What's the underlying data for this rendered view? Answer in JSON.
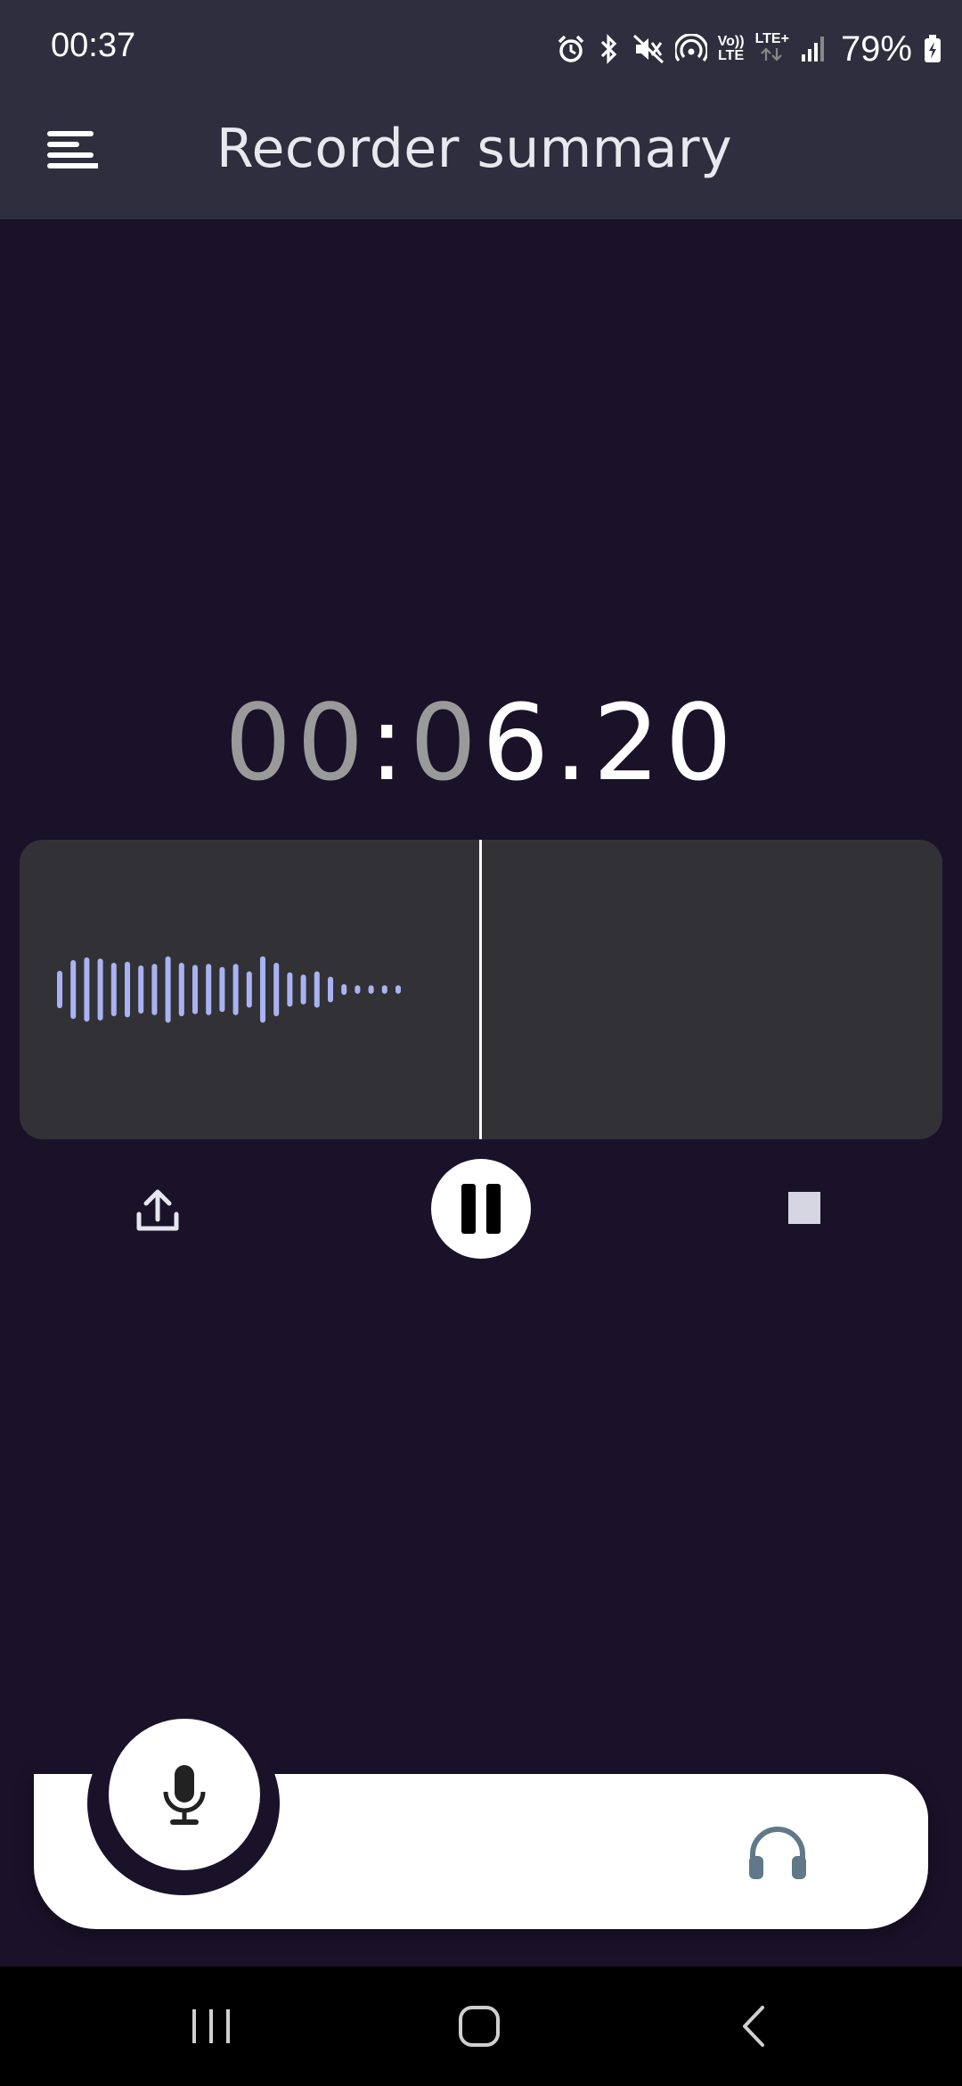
{
  "status_bar": {
    "time": "00:37",
    "battery": "79%",
    "lte_top": "Vo))",
    "lte_bottom": "LTE",
    "lte_plus": "LTE+",
    "icons": [
      "alarm-icon",
      "bluetooth-icon",
      "mute-icon",
      "hotspot-icon",
      "volte-icon",
      "lte-plus-icon",
      "signal-icon",
      "battery-charging-icon"
    ]
  },
  "app_bar": {
    "title": "Recorder summary",
    "menu_icon": "menu-icon"
  },
  "timer": {
    "minutes": "00",
    "sep1": ":",
    "seconds": "06",
    "sep2": ".",
    "hundredths": "20"
  },
  "waveform": {
    "color": "#a9b3f2",
    "levels": [
      0.35,
      0.55,
      0.6,
      0.58,
      0.5,
      0.52,
      0.45,
      0.48,
      0.62,
      0.5,
      0.46,
      0.48,
      0.42,
      0.48,
      0.34,
      0.62,
      0.5,
      0.32,
      0.28,
      0.34,
      0.24,
      0.1,
      0.08,
      0.08,
      0.08,
      0.08
    ]
  },
  "controls": {
    "share_icon": "share-upload-icon",
    "pause_icon": "pause-icon",
    "stop_icon": "stop-icon"
  },
  "bottom_nav": {
    "mic_icon": "microphone-icon",
    "headphones_icon": "headphones-icon"
  },
  "system_nav": {
    "recents_icon": "recents-icon",
    "home_icon": "home-icon",
    "back_icon": "back-icon"
  },
  "colors": {
    "background": "#1a1229",
    "app_bar": "#2e2e3e",
    "panel": "#323236",
    "accent_wave": "#a9b3f2"
  }
}
